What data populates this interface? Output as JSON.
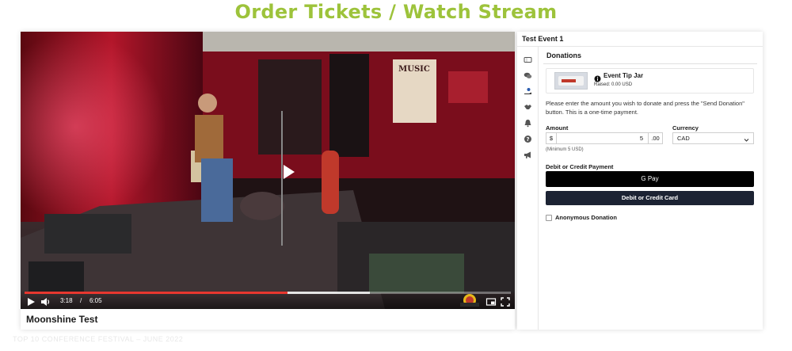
{
  "page": {
    "title": "Order Tickets / Watch Stream",
    "footer_watermark": "TOP 10 CONFERENCE FESTIVAL – JUNE 2022"
  },
  "video": {
    "caption": "Moonshine Test",
    "current_time": "3:18",
    "separator": "/",
    "duration": "6:05",
    "played_fraction": 0.54,
    "buffered_fraction": 0.71,
    "poster_sign": "MUSIC"
  },
  "panel": {
    "event_title": "Test Event 1",
    "rail_icons": [
      "ticket-icon",
      "chat-icon",
      "donate-hand-icon",
      "handshake-icon",
      "bell-icon",
      "help-icon",
      "megaphone-icon"
    ]
  },
  "donations": {
    "section_title": "Donations",
    "tip_jar_title": "Event Tip Jar",
    "tip_jar_raised": "Raised: 0.00 USD",
    "description": "Please enter the amount you wish to donate and press the \"Send Donation\" button. This is a one-time payment.",
    "amount_label": "Amount",
    "amount_prefix": "$",
    "amount_value": "5",
    "amount_suffix": ".00",
    "minimum_note": "(Minimum 5 USD)",
    "currency_label": "Currency",
    "currency_value": "CAD",
    "payment_label": "Debit or Credit Payment",
    "gpay_label": "G Pay",
    "card_button": "Debit or Credit Card",
    "anonymous_label": "Anonymous Donation",
    "anonymous_checked": false
  },
  "colors": {
    "title_green": "#9dc33b",
    "progress_red": "#e8372f",
    "card_button_bg": "#1c2333"
  }
}
